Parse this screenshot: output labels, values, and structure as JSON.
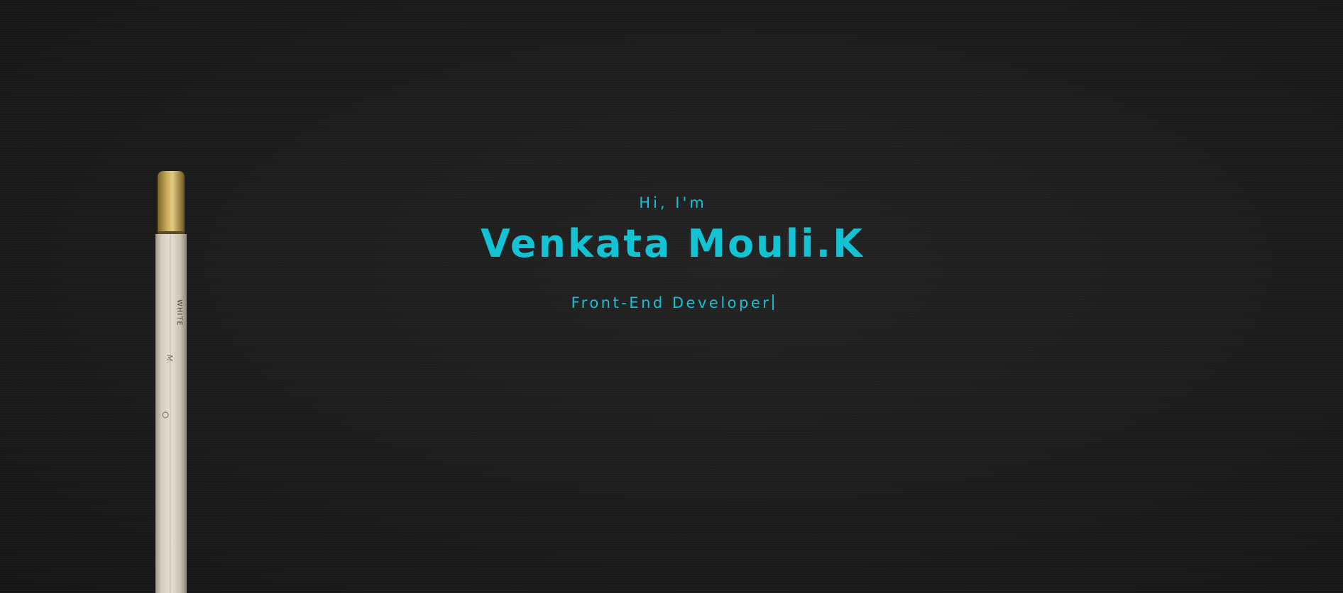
{
  "colors": {
    "accent": "#13c3d3",
    "background": "#1b1b1b",
    "pencil_body": "#d9d3c4",
    "pencil_ferrule": "#b89b4c"
  },
  "hero": {
    "greeting": "Hi, I'm",
    "name": "Venkata Mouli.K",
    "role": "Front-End Developer"
  },
  "decor": {
    "icon": "pencil-icon",
    "pencil_label": "WHITE"
  }
}
